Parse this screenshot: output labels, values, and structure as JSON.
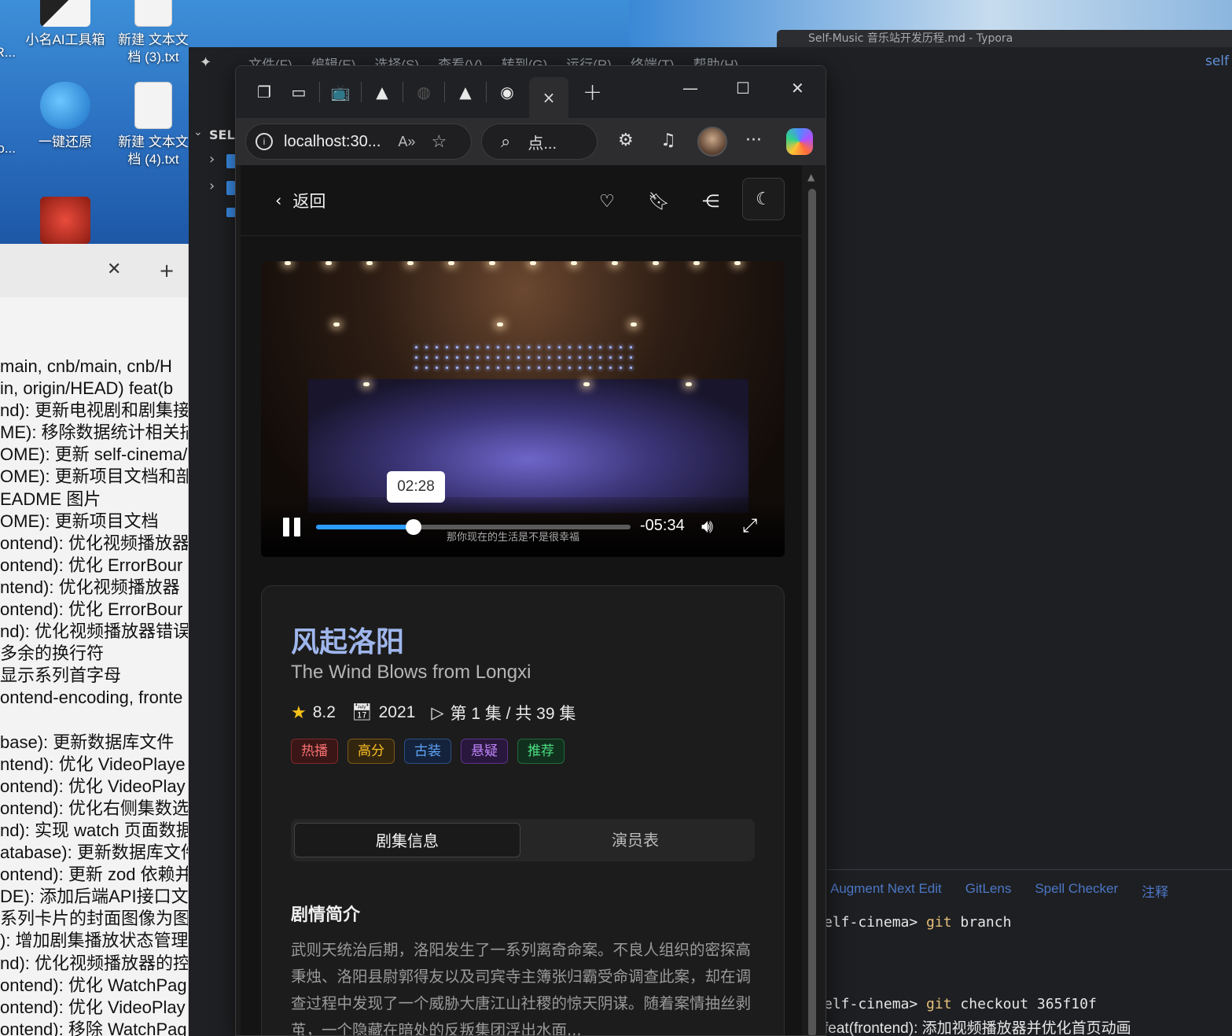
{
  "desktop": {
    "icons": [
      {
        "label": "小名AI工具箱"
      },
      {
        "label": "新建 文本文\n档 (3).txt"
      },
      {
        "label": "一键还原"
      },
      {
        "label": "新建 文本文\n档 (4).txt"
      }
    ],
    "edge_fragments": [
      "R...",
      "o..."
    ]
  },
  "left_terminal": {
    "lines": [
      "main, cnb/main, cnb/H",
      "in, origin/HEAD) feat(b",
      "nd): 更新电视剧和剧集接",
      "ME): 移除数据统计相关描",
      "OME): 更新 self-cinema/",
      "OME): 更新项目文档和部署",
      "EADME 图片",
      "OME): 更新项目文档",
      "ontend): 优化视频播放器",
      "ontend): 优化 ErrorBour",
      "ntend): 优化视频播放器",
      "ontend): 优化 ErrorBour",
      "nd): 优化视频播放器错误",
      "多余的换行符",
      "显示系列首字母",
      "ontend-encoding, fronte",
      "",
      "base): 更新数据库文件",
      "ntend): 优化 VideoPlaye",
      "ontend): 优化 VideoPlay",
      "ontend): 优化右侧集数选",
      "nd): 实现 watch 页面数据",
      "atabase): 更新数据库文件",
      "ontend): 更新 zod 依赖并",
      "DE): 添加后端API接口文",
      "系列卡片的封面图像为图",
      "): 增加剧集播放状态管理",
      "nd): 优化视频播放器的控",
      "ontend): 优化 WatchPag",
      "ontend): 优化 VideoPlay",
      "ontend): 移除 WatchPag"
    ]
  },
  "ide": {
    "menu": [
      "文件(F)",
      "编辑(E)",
      "选择(S)",
      "查看(V)",
      "转到(G)",
      "运行(R)",
      "终端(T)",
      "帮助(H)"
    ],
    "window_title": "Self-Music 音乐站开发历程.md - Typora",
    "right_label": "self",
    "explorer_label": "SELF",
    "panel_tabs": [
      "Augment Next Edit",
      "GitLens",
      "Spell Checker",
      "注释"
    ],
    "terminal": [
      {
        "prompt": "elf-cinema> ",
        "cmd": "git",
        "rest": " branch"
      },
      {
        "prompt": "elf-cinema> ",
        "cmd": "git",
        "rest": " checkout 365f10f"
      },
      {
        "prompt": " feat(frontend): 添加视频播放器并优化首页动画",
        "cmd": "",
        "rest": ""
      }
    ]
  },
  "browser": {
    "url": "localhost:30...",
    "search_placeholder": "点...",
    "tab_close": "×"
  },
  "page": {
    "back_label": "返回",
    "video": {
      "tooltip_time": "02:28",
      "remaining": "-05:34",
      "progress": 0.31,
      "subtitle": "那你现在的生活是不是很幸福"
    },
    "title_cn": "风起洛阳",
    "title_en": "The Wind Blows from Longxi",
    "rating": "8.2",
    "year": "2021",
    "episode": "第 1 集 / 共 39 集",
    "tags": [
      {
        "label": "热播",
        "color": "#f87171",
        "bg": "#3a1616",
        "border": "#7f2a2a"
      },
      {
        "label": "高分",
        "color": "#fbbf24",
        "bg": "#33260f",
        "border": "#7a5a1c"
      },
      {
        "label": "古装",
        "color": "#60a5fa",
        "bg": "#14233b",
        "border": "#2c4f82"
      },
      {
        "label": "悬疑",
        "color": "#c084fc",
        "bg": "#2a173d",
        "border": "#5b3487"
      },
      {
        "label": "推荐",
        "color": "#4ade80",
        "bg": "#12301e",
        "border": "#236a3c"
      }
    ],
    "tabs": {
      "info": "剧集信息",
      "cast": "演员表"
    },
    "synopsis_title": "剧情简介",
    "synopsis": "武则天统治后期，洛阳发生了一系列离奇命案。不良人组织的密探高秉烛、洛阳县尉郭得友以及司宾寺主簿张归霸受命调查此案，却在调查过程中发现了一个威胁大唐江山社稷的惊天阴谋。随着案情抽丝剥茧，一个隐藏在暗处的反叛集团浮出水面..."
  }
}
